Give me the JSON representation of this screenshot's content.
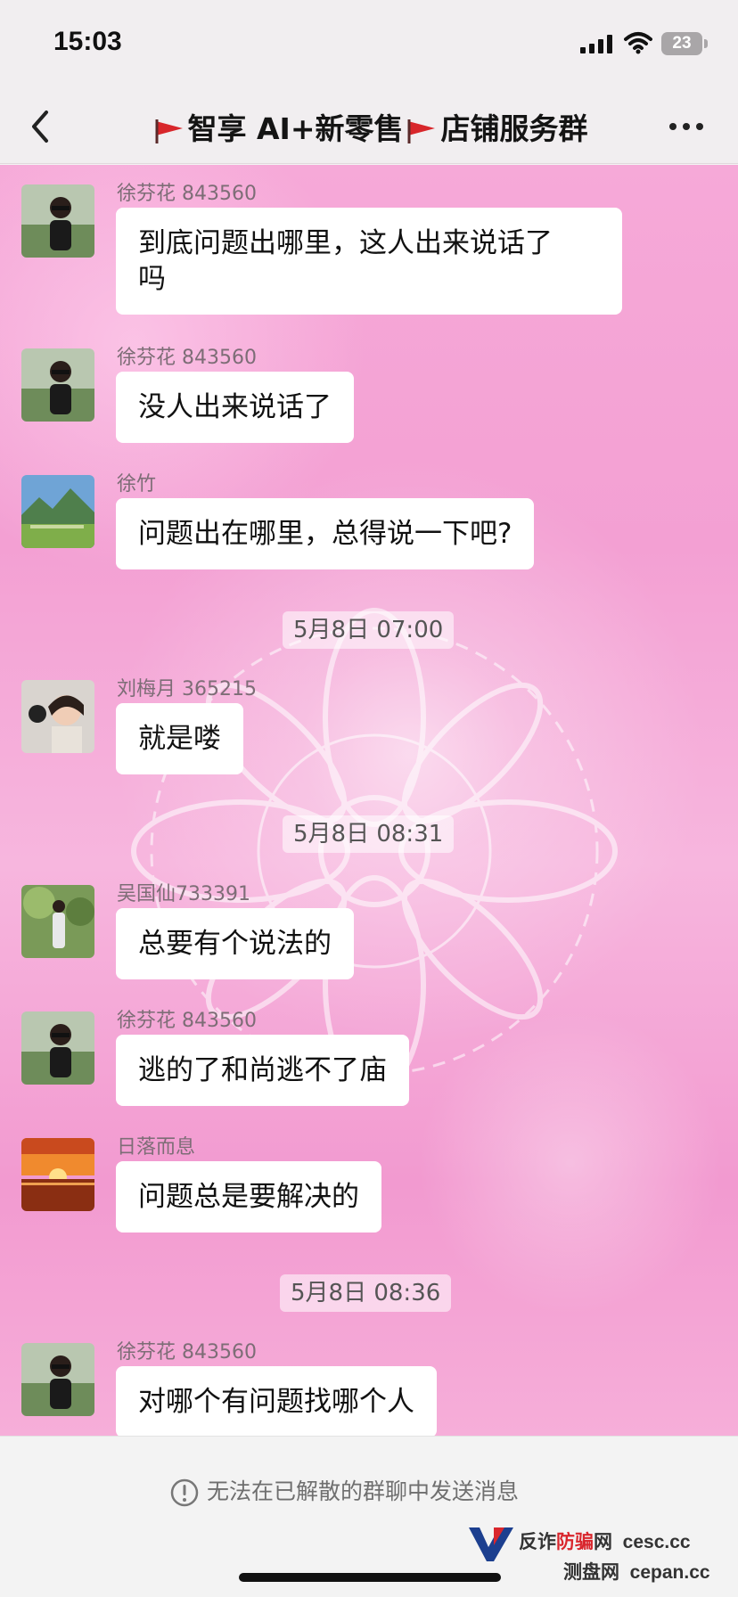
{
  "status_bar": {
    "time": "15:03",
    "battery": "23"
  },
  "nav": {
    "title_part1": "智享 AI+新零售",
    "title_part2": "店铺服务群"
  },
  "messages": [
    {
      "sender": "徐芬花 843560",
      "line1": "到底问题出哪里，这人出来说话了",
      "line2": "吗"
    },
    {
      "sender": "徐芬花 843560",
      "text": "没人出来说话了"
    },
    {
      "sender": "徐竹",
      "text": "问题出在哪里，总得说一下吧?"
    },
    {
      "timestamp": "5月8日 07:00"
    },
    {
      "sender": "刘梅月 365215",
      "text": "就是喽"
    },
    {
      "timestamp": "5月8日 08:31"
    },
    {
      "sender": "吴国仙733391",
      "text": "总要有个说法的"
    },
    {
      "sender": "徐芬花 843560",
      "text": "逃的了和尚逃不了庙"
    },
    {
      "sender": "日落而息",
      "text": "问题总是要解决的"
    },
    {
      "timestamp": "5月8日 08:36"
    },
    {
      "sender": "徐芬花 843560",
      "text": "对哪个有问题找哪个人"
    }
  ],
  "footer": {
    "notice": "无法在已解散的群聊中发送消息"
  },
  "watermark": {
    "line1_a": "反诈",
    "line1_b": "防骗",
    "line1_c": "网",
    "line1_d": "cesc.cc",
    "line2_a": "测盘网",
    "line2_b": "cepan.cc"
  },
  "colors": {
    "chat_background": "#f3a0d3",
    "bubble": "#ffffff",
    "flag_red": "#d8262b"
  }
}
